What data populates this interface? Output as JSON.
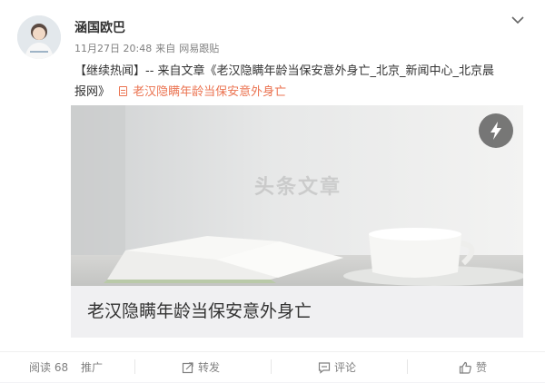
{
  "post": {
    "username": "涵国欧巴",
    "time": "11月27日 20:48",
    "source_prefix": "来自",
    "source": "网易跟贴",
    "text_line1": "【继续热闻】-- 来自文章《老汉隐瞒年龄当保安意外身亡_北京_新闻中心_北京晨",
    "text_line2": "报网》",
    "article_link": "老汉隐瞒年龄当保安意外身亡"
  },
  "article_card": {
    "watermark": "头条文章",
    "title": "老汉隐瞒年龄当保安意外身亡"
  },
  "footer": {
    "read_label": "阅读",
    "read_count": "68",
    "promote": "推广",
    "repost": "转发",
    "comment": "评论",
    "like": "赞"
  },
  "icons": {
    "chevron": "chevron-down-icon",
    "flash": "lightning-icon",
    "repost": "repost-icon",
    "comment": "comment-icon",
    "like": "thumbs-up-icon",
    "link": "document-link-icon"
  },
  "colors": {
    "link": "#eb7350",
    "muted": "#808080",
    "text": "#333333"
  }
}
